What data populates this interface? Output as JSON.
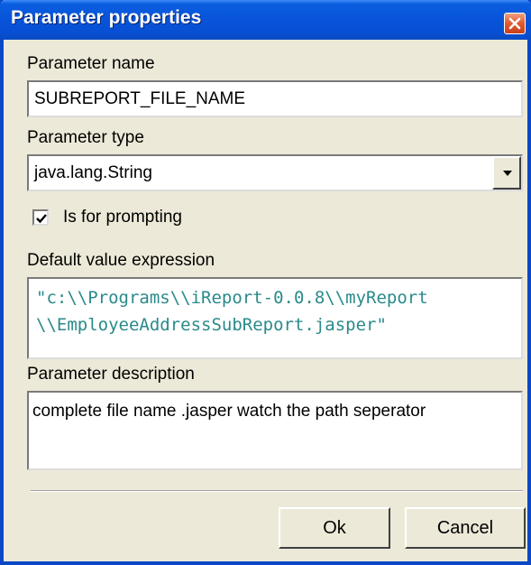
{
  "window": {
    "title": "Parameter properties",
    "close_icon": "close-icon",
    "accent": "#0A48C8",
    "background": "#ECE9D8"
  },
  "parameter_name": {
    "label": "Parameter name",
    "value": "SUBREPORT_FILE_NAME"
  },
  "parameter_type": {
    "label": "Parameter type",
    "selected": "java.lang.String",
    "dropdown_icon": "chevron-down-icon"
  },
  "prompting": {
    "label": "Is for prompting",
    "checked": true
  },
  "default_value": {
    "label": "Default value expression",
    "lines": [
      "\"c:\\\\Programs\\\\iReport-0.0.8\\\\myReport",
      "\\\\EmployeeAddressSubReport.jasper\""
    ],
    "text_color": "#2A8A8A"
  },
  "description": {
    "label": "Parameter description",
    "value": "complete file name .jasper watch the path seperator"
  },
  "buttons": {
    "ok": "Ok",
    "cancel": "Cancel"
  }
}
